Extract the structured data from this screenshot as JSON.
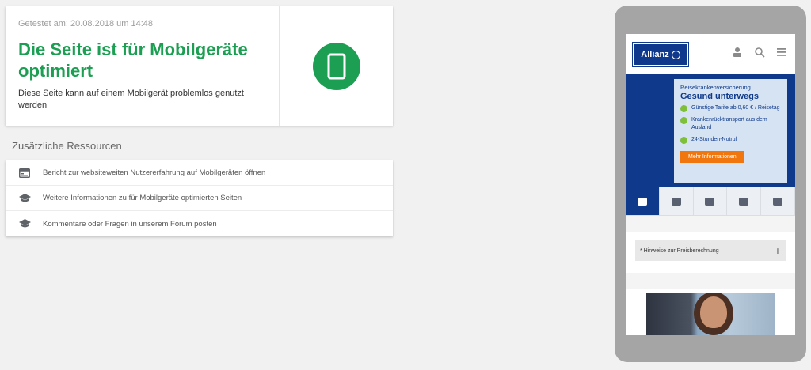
{
  "result": {
    "tested_at": "Getestet am: 20.08.2018 um 14:48",
    "verdict": "Die Seite ist für Mobilgeräte optimiert",
    "description": "Diese Seite kann auf einem Mobilgerät problemlos genutzt werden",
    "icon": "mobile-phone-icon",
    "accent_color": "#1c9f52"
  },
  "resources": {
    "title": "Zusätzliche Ressourcen",
    "items": [
      {
        "label": "Bericht zur websiteweiten Nutzererfahrung auf Mobilgeräten öffnen",
        "icon": "report-icon"
      },
      {
        "label": "Weitere Informationen zu für Mobilgeräte optimierten Seiten",
        "icon": "graduation-cap-icon"
      },
      {
        "label": "Kommentare oder Fragen in unserem Forum posten",
        "icon": "graduation-cap-icon"
      }
    ]
  },
  "preview": {
    "logo": "Allianz",
    "header_icons": [
      "user-icon",
      "search-icon",
      "menu-icon"
    ],
    "hero": {
      "kicker": "Reisekrankenversicherung",
      "headline": "Gesund unterwegs",
      "bullets": [
        "Günstige Tarife ab 0,60 € / Reisetag",
        "Krankenrücktransport aus dem Ausland",
        "24-Stunden-Notruf"
      ],
      "cta": "Mehr Informationen",
      "brand_color": "#0f3a8c",
      "cta_color": "#f2760e"
    },
    "accordion_label": "* Hinweise zur Preisberechnung",
    "accordion_icon": "+"
  }
}
